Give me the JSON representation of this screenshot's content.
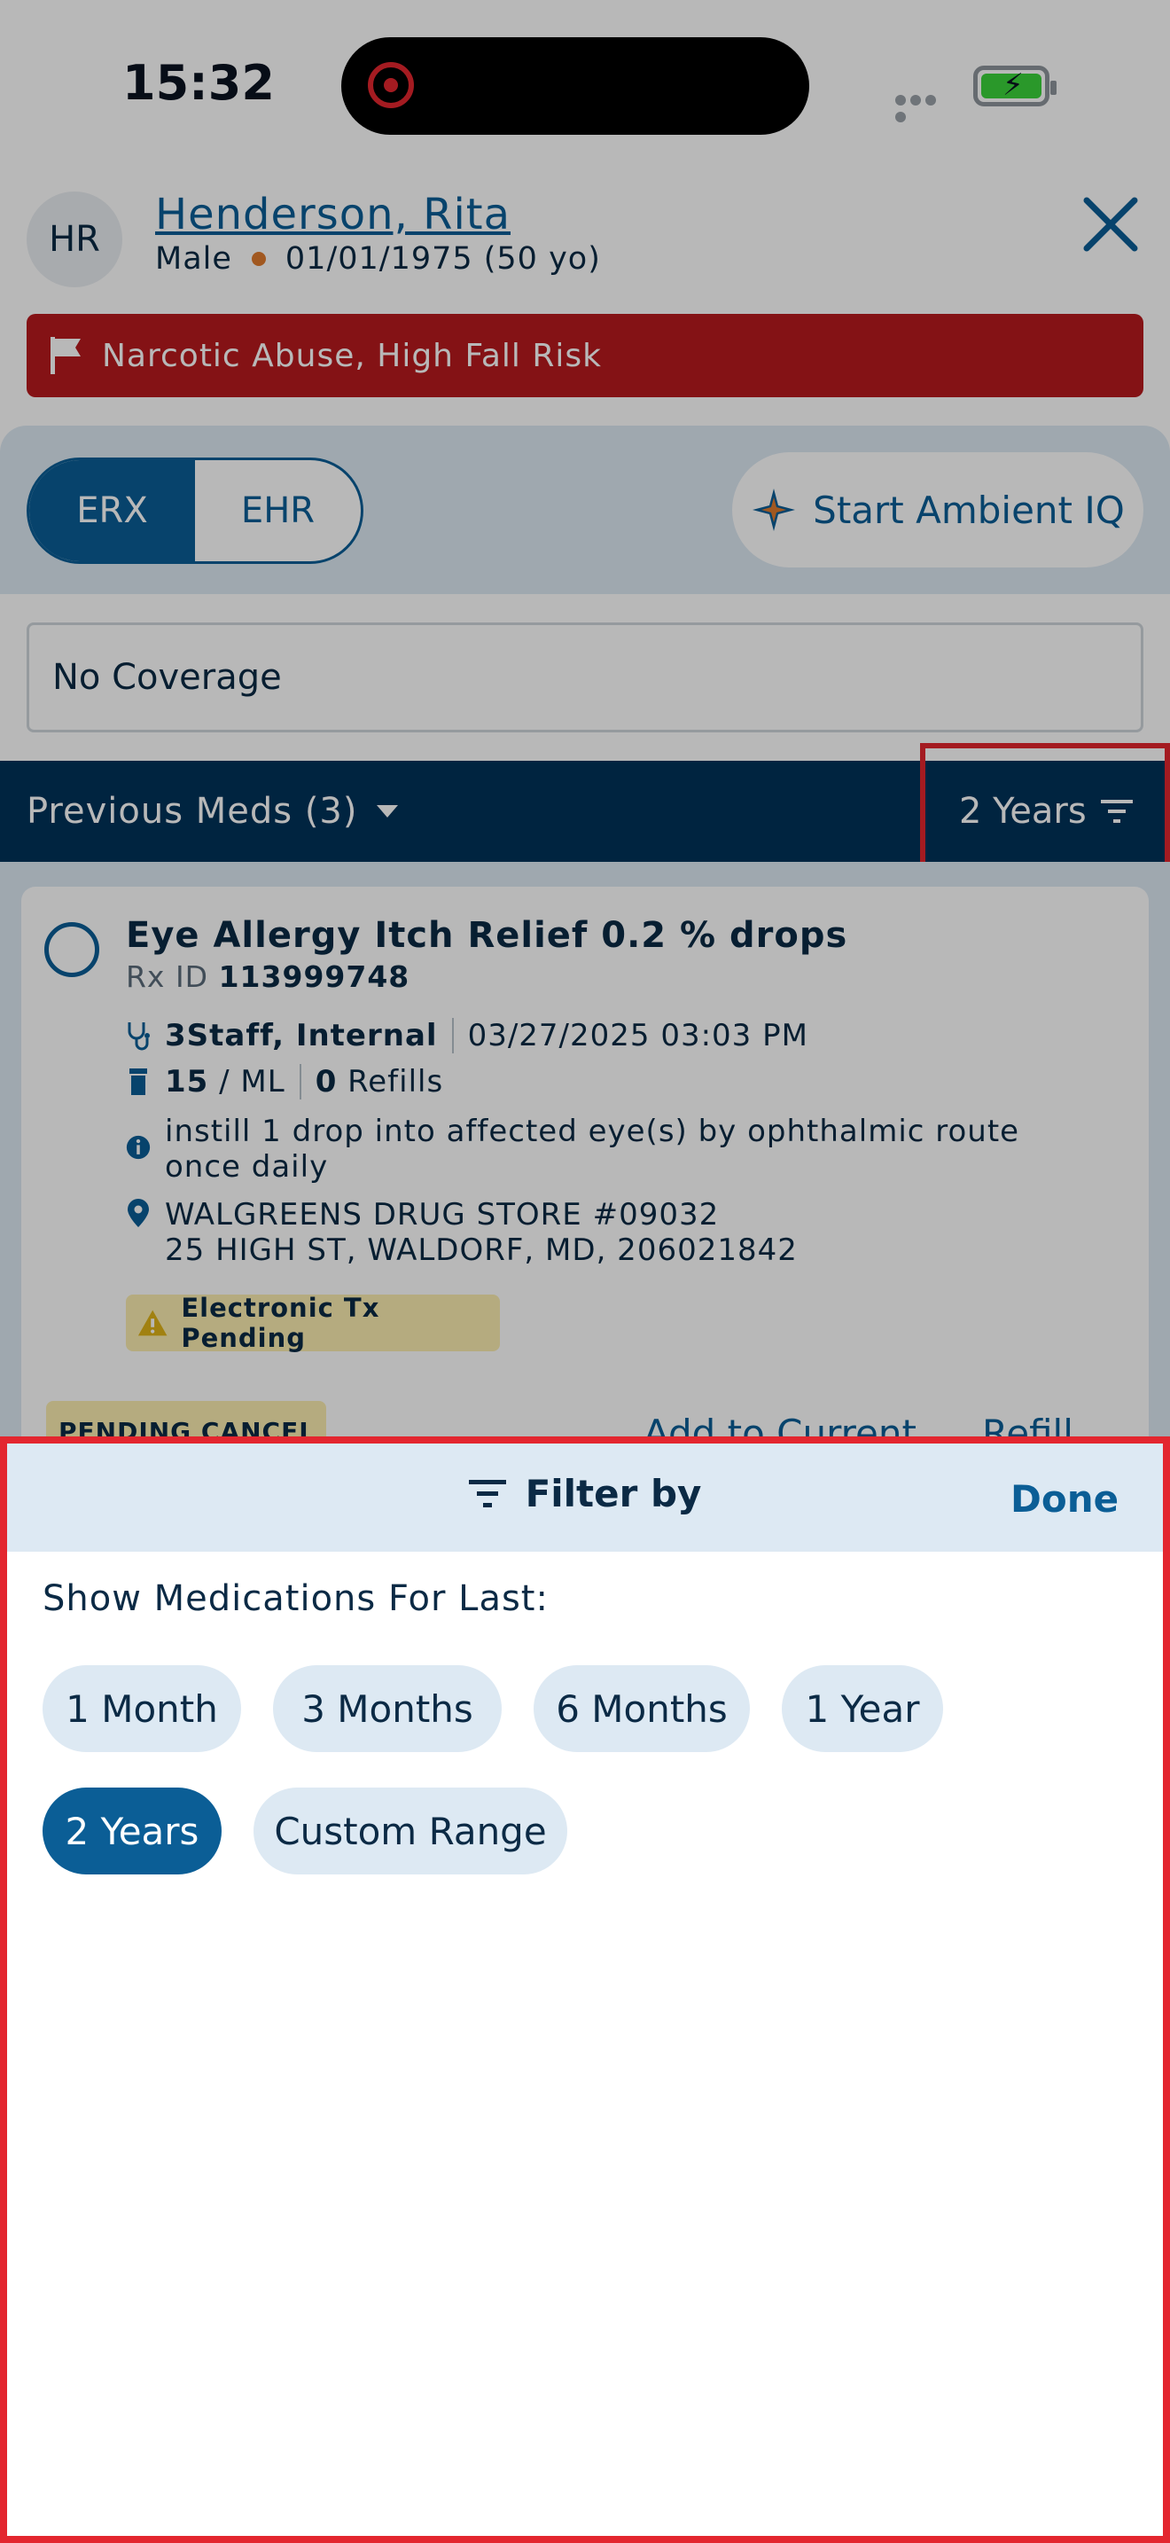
{
  "status": {
    "time": "15:32"
  },
  "patient": {
    "initials": "HR",
    "name": "Henderson, Rita",
    "sex": "Male",
    "dob": "01/01/1975 (50 yo)",
    "alert": "Narcotic Abuse, High Fall Risk"
  },
  "tabs": {
    "erx": "ERX",
    "ehr": "EHR",
    "ambient": "Start Ambient IQ"
  },
  "coverage": "No Coverage",
  "meds_bar": {
    "title": "Previous Meds (3)",
    "period": "2 Years"
  },
  "med": {
    "name": "Eye Allergy Itch Relief 0.2 % drops",
    "rx_label": "Rx ID",
    "rx_id": "113999748",
    "prescriber": "3Staff, Internal",
    "datetime": "03/27/2025 03:03 PM",
    "qty": "15",
    "unit": "/ ML",
    "refills_count": "0",
    "refills_label": "Refills",
    "sig_line1": "instill 1 drop into affected eye(s) by ophthalmic route",
    "sig_line2": "once daily",
    "pharmacy_name": "WALGREENS DRUG STORE #09032",
    "pharmacy_addr": "25 HIGH ST, WALDORF, MD, 206021842",
    "status_badge": "Electronic Tx Pending",
    "cancel_badge": "PENDING CANCEL",
    "add_label": "Add to Current",
    "refill_label": "Refill"
  },
  "filter": {
    "title": "Filter by",
    "done": "Done",
    "label": "Show Medications For Last:",
    "options": [
      "1 Month",
      "3 Months",
      "6 Months",
      "1 Year",
      "2 Years",
      "Custom Range"
    ],
    "selected": "2 Years"
  },
  "colors": {
    "primary": "#0b5e96",
    "navy": "#013259",
    "alert": "#b81a1e",
    "highlight": "#e3262f",
    "chip": "#dde9f3"
  }
}
